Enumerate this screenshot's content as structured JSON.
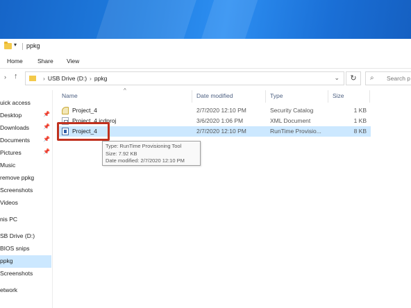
{
  "window": {
    "title": "ppkg",
    "quick_access_arrow": "▾"
  },
  "ribbon": {
    "tabs": [
      "Home",
      "Share",
      "View"
    ]
  },
  "address": {
    "crumbs": [
      "USB Drive (D:)",
      "ppkg"
    ],
    "separator": "›"
  },
  "search": {
    "placeholder": "Search p"
  },
  "nav_pane": {
    "items": [
      {
        "label": "uick access",
        "pinned": false,
        "selected": false
      },
      {
        "label": "Desktop",
        "pinned": true,
        "selected": false
      },
      {
        "label": "Downloads",
        "pinned": true,
        "selected": false
      },
      {
        "label": "Documents",
        "pinned": true,
        "selected": false
      },
      {
        "label": "Pictures",
        "pinned": true,
        "selected": false
      },
      {
        "label": "Music",
        "pinned": false,
        "selected": false
      },
      {
        "label": "remove ppkg",
        "pinned": false,
        "selected": false
      },
      {
        "label": "Screenshots",
        "pinned": false,
        "selected": false
      },
      {
        "label": "Videos",
        "pinned": false,
        "selected": false
      },
      {
        "label": "nis PC",
        "pinned": false,
        "selected": false
      },
      {
        "label": "SB Drive (D:)",
        "pinned": false,
        "selected": false
      },
      {
        "label": "BIOS snips",
        "pinned": false,
        "selected": false
      },
      {
        "label": "ppkg",
        "pinned": false,
        "selected": true
      },
      {
        "label": "Screenshots",
        "pinned": false,
        "selected": false
      },
      {
        "label": "etwork",
        "pinned": false,
        "selected": false
      }
    ]
  },
  "columns": {
    "name": "Name",
    "date": "Date modified",
    "type": "Type",
    "size": "Size"
  },
  "files": [
    {
      "name": "Project_4",
      "date": "2/7/2020 12:10 PM",
      "type": "Security Catalog",
      "size": "1 KB",
      "icon": "catalog-icon"
    },
    {
      "name": "Project_4.icdproj",
      "date": "3/6/2020 1:06 PM",
      "type": "XML Document",
      "size": "1 KB",
      "icon": "xml-icon"
    },
    {
      "name": "Project_4",
      "date": "2/7/2020 12:10 PM",
      "type": "RunTime Provisio...",
      "size": "8 KB",
      "icon": "provisioning-package-icon"
    }
  ],
  "tooltip": {
    "type": "Type: RunTime Provisioning Tool",
    "size": "Size: 7.92 KB",
    "date": "Date modified: 2/7/2020 12:10 PM"
  },
  "colors": {
    "selection": "#cce8ff",
    "highlight_box": "#c0311f",
    "desktop_blue": "#1f7de0"
  }
}
